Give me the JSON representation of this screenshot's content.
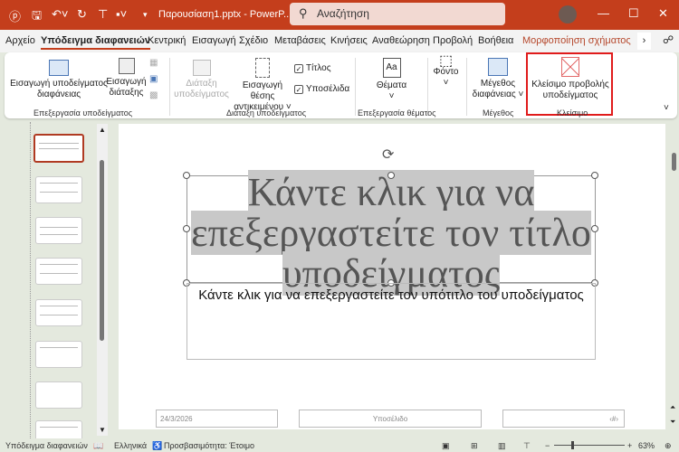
{
  "titlebar": {
    "doc_title": "Παρουσίαση1.pptx - PowerP...",
    "search_placeholder": "Αναζήτηση",
    "accent": "#c43e1c"
  },
  "tabs": [
    "Αρχείο",
    "Υπόδειγμα διαφανειών",
    "Κεντρική",
    "Εισαγωγή",
    "Σχέδιο",
    "Μεταβάσεις",
    "Κινήσεις",
    "Αναθεώρηση",
    "Προβολή",
    "Βοήθεια",
    "Μορφοποίηση σχήματος"
  ],
  "ribbon": {
    "insert_master": [
      "Εισαγωγή υποδείγματος",
      "διαφάνειας"
    ],
    "insert_layout": [
      "Εισαγωγή",
      "διάταξης"
    ],
    "layout_master": [
      "Διάταξη",
      "υποδείγματος"
    ],
    "insert_placeholder": [
      "Εισαγωγή θέσης",
      "αντικειμένου ˅"
    ],
    "title_check": "Τίτλος",
    "footers_check": "Υποσέλιδα",
    "themes": "Θέματα",
    "fonts": "Φόντο",
    "slide_size": [
      "Μέγεθος",
      "διαφάνειας ˅"
    ],
    "close_master": [
      "Κλείσιμο προβολής",
      "υποδείγματος"
    ],
    "groups": [
      "Επεξεργασία υποδείγματος",
      "Διάταξη υποδείγματος",
      "Επεξεργασία θέματος",
      "Μέγεθος",
      "Κλείσιμο"
    ]
  },
  "slide": {
    "title": "Κάντε κλικ για να επεξεργαστείτε τον τίτλο υποδείγματος",
    "subtitle": "Κάντε κλικ για να επεξεργαστείτε τον υπότιτλο του υποδείγματος",
    "date": "24/3/2026",
    "footer": "Υποσέλιδο",
    "number": "‹#›"
  },
  "status": {
    "view": "Υπόδειγμα διαφανειών",
    "language": "Ελληνικά",
    "accessibility": "Προσβασιμότητα: Έτοιμο",
    "zoom": "63%"
  }
}
